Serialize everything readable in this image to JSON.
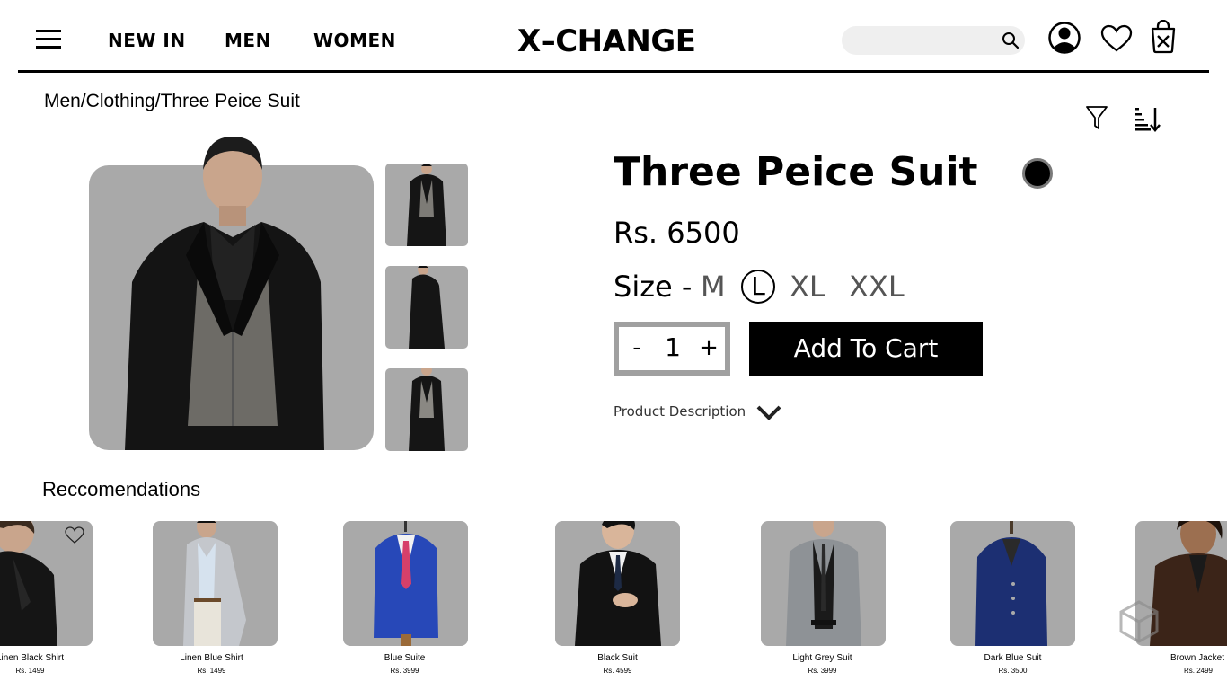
{
  "header": {
    "nav": [
      "NEW IN",
      "MEN",
      "WOMEN"
    ],
    "logo": "X–CHANGE",
    "search_placeholder": ""
  },
  "breadcrumb": "Men/Clothing/Three Peice Suit",
  "product": {
    "title": "Three Peice Suit",
    "price": "Rs. 6500",
    "color": "#000000",
    "size_label": "Size -",
    "sizes": [
      "M",
      "L",
      "XL",
      "XXL"
    ],
    "selected_size": "L",
    "quantity": "1",
    "qty_minus": "-",
    "qty_plus": "+",
    "add_to_cart": "Add To Cart",
    "description_toggle": "Product Description"
  },
  "recommendations": {
    "title": "Reccomendations",
    "items": [
      {
        "name": "Linen Black Shirt",
        "price": "Rs. 1499"
      },
      {
        "name": "Linen Blue Shirt",
        "price": "Rs. 1499"
      },
      {
        "name": "Blue Suite",
        "price": "Rs. 3999"
      },
      {
        "name": "Black Suit",
        "price": "Rs. 4599"
      },
      {
        "name": "Light Grey Suit",
        "price": "Rs. 3999"
      },
      {
        "name": "Dark Blue Suit",
        "price": "Rs. 3500"
      },
      {
        "name": "Brown Jacket",
        "price": "Rs. 2499"
      }
    ]
  },
  "icons": {
    "menu": "hamburger-icon",
    "search": "search-icon",
    "account": "user-icon",
    "wishlist": "heart-icon",
    "cart": "shopping-bag-icon",
    "filter": "filter-icon",
    "sort": "sort-icon",
    "description": "chevron-down-icon"
  }
}
